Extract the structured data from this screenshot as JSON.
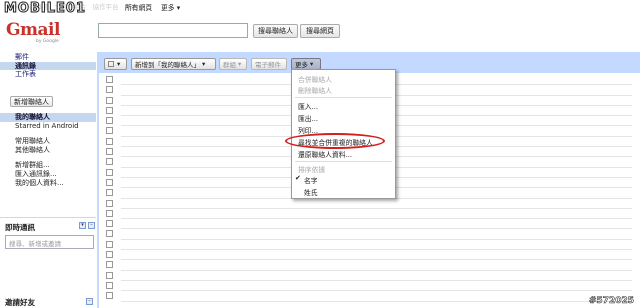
{
  "top_nav": {
    "links": [
      "Gmail",
      "行事曆",
      "文件",
      "相片",
      "協作平台",
      "網路"
    ],
    "all_web": "所有網頁",
    "more": "更多 ▾"
  },
  "logo": {
    "text": "Gmail",
    "sub": "by Google"
  },
  "watermark_logo": "MOBILE01",
  "search": {
    "value": "",
    "search_contacts": "搜尋聯絡人",
    "search_web": "搜尋網頁"
  },
  "sidebar": {
    "nav": [
      "郵件",
      "通訊錄",
      "工作表"
    ],
    "new_contact": "新增聯絡人",
    "groups": [
      "我的聯絡人",
      "Starred in Android",
      "",
      "常用聯絡人",
      "其他聯絡人",
      "",
      "新增群組...",
      "匯入通訊錄...",
      "我的個人資料..."
    ]
  },
  "chat": {
    "title": "即時通訊",
    "placeholder": "搜尋、新增或邀請"
  },
  "invite": {
    "title": "邀請好友"
  },
  "toolbar": {
    "add_to_group": "新增到「我的聯絡人」",
    "group": "群組",
    "email": "電子郵件",
    "more": "更多"
  },
  "more_menu": {
    "merge": "合併聯絡人",
    "delete": "刪除聯絡人",
    "import": "匯入...",
    "export": "匯出...",
    "print": "列印...",
    "find_duplicates": "尋找並合併重複的聯絡人",
    "restore": "還原聯絡人資料...",
    "sort_label": "排序依據",
    "sort_first": "名字",
    "sort_last": "姓氏"
  },
  "watermark_id": "#572025",
  "colors": {
    "toolbar_bg": "#c3d9ff",
    "selected_bg": "#c5d6ef",
    "highlight": "#d21f1f",
    "gmail_red": "#c9322b"
  }
}
